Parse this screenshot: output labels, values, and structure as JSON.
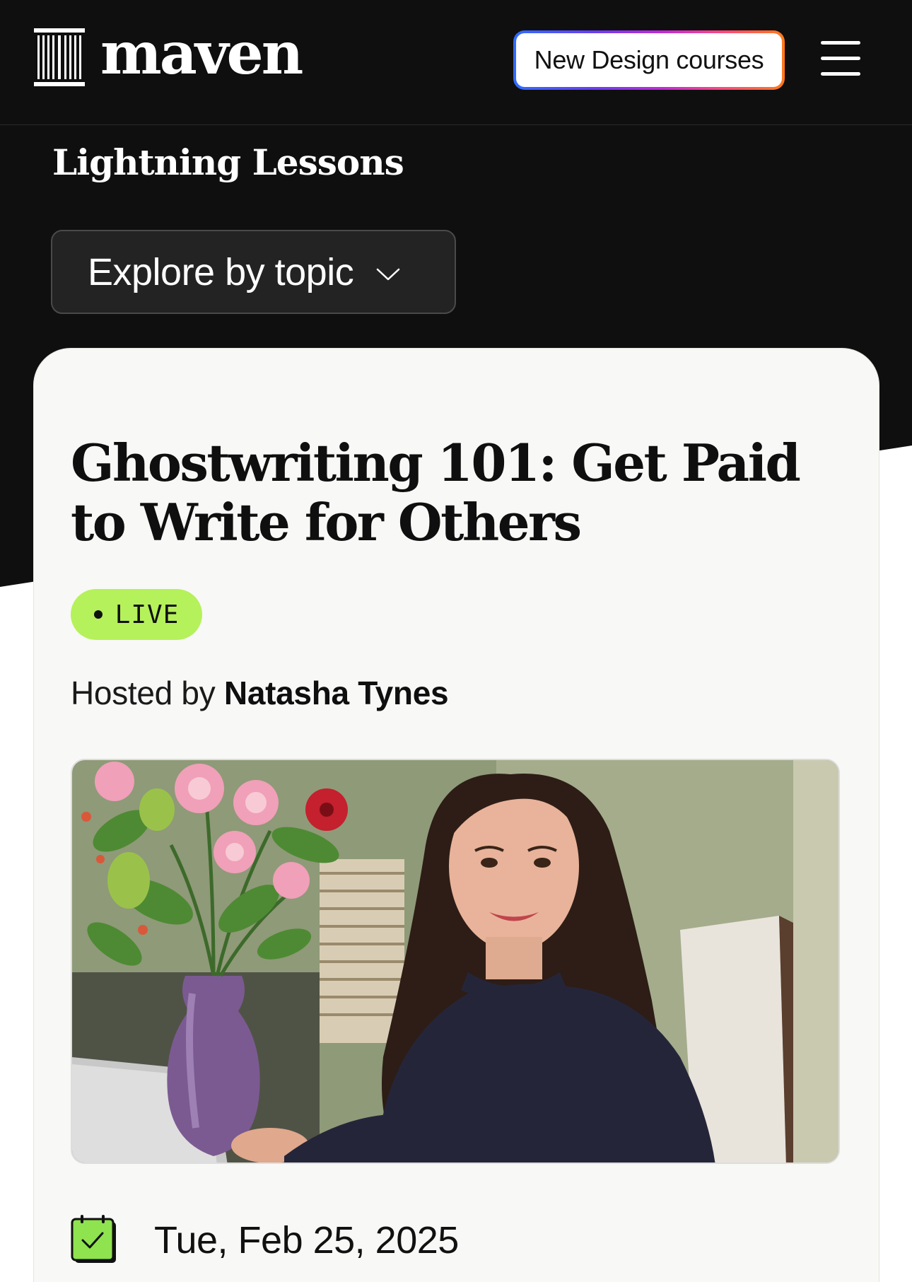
{
  "header": {
    "logo_text": "maven",
    "promo_button_label": "New Design courses",
    "menu_icon": "hamburger-menu-icon"
  },
  "section": {
    "title": "Lightning Lessons",
    "explore_label": "Explore by topic",
    "explore_icon": "chevron-down-icon"
  },
  "lesson": {
    "title": "Ghostwriting 101: Get Paid to Write for Others",
    "status_badge": "LIVE",
    "hosted_prefix": "Hosted by",
    "host_name": "Natasha Tynes",
    "photo_alt": "Natasha Tynes",
    "date_icon": "calendar-check-icon",
    "date": "Tue, Feb 25, 2025"
  },
  "colors": {
    "hero_background": "#0f0f0f",
    "card_background": "#f8f8f6",
    "live_badge": "#b5f15a",
    "calendar_icon": "#8ee34f"
  }
}
